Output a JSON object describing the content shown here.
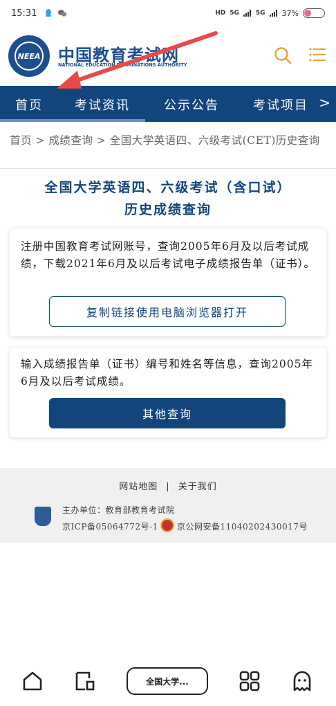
{
  "status_bar": {
    "time": "15:31",
    "hd": "HD",
    "signal1": "5G",
    "signal2": "5G",
    "battery_percent": "37%",
    "battery_level": 0.37
  },
  "header": {
    "logo_text": "NEEA",
    "title": "中国教育考试网",
    "subtitle": "NATIONAL EDUCATION EXAMINATIONS AUTHORITY",
    "search_icon": "search-icon",
    "menu_icon": "menu-icon"
  },
  "nav": {
    "items": [
      "首页",
      "考试资讯",
      "公示公告",
      "考试项目"
    ],
    "more": ">"
  },
  "breadcrumb": "首页 > 成绩查询 > 全国大学英语四、六级考试(CET)历史查询",
  "page_title": {
    "line1": "全国大学英语四、六级考试（含口试）",
    "line2": "历史成绩查询"
  },
  "card1": {
    "text": "注册中国教育考试网账号，查询2005年6月及以后考试成绩，下载2021年6月及以后考试电子成绩报告单（证书）。",
    "button": "复制链接使用电脑浏览器打开"
  },
  "card2": {
    "text": "输入成绩报告单（证书）编号和姓名等信息，查询2005年6月及以后考试成绩。",
    "button": "其他查询"
  },
  "footer": {
    "link1": "网站地图",
    "separator": "|",
    "link2": "关于我们",
    "sponsor": "主办单位：教育部教育考试院",
    "icp": "京ICP备05064772号-1",
    "police": "京公网安备11040202430017号"
  },
  "bottom_bar": {
    "tab_label": "全国大学..."
  },
  "colors": {
    "brand": "#12457c",
    "annotation": "#e84a4a"
  }
}
